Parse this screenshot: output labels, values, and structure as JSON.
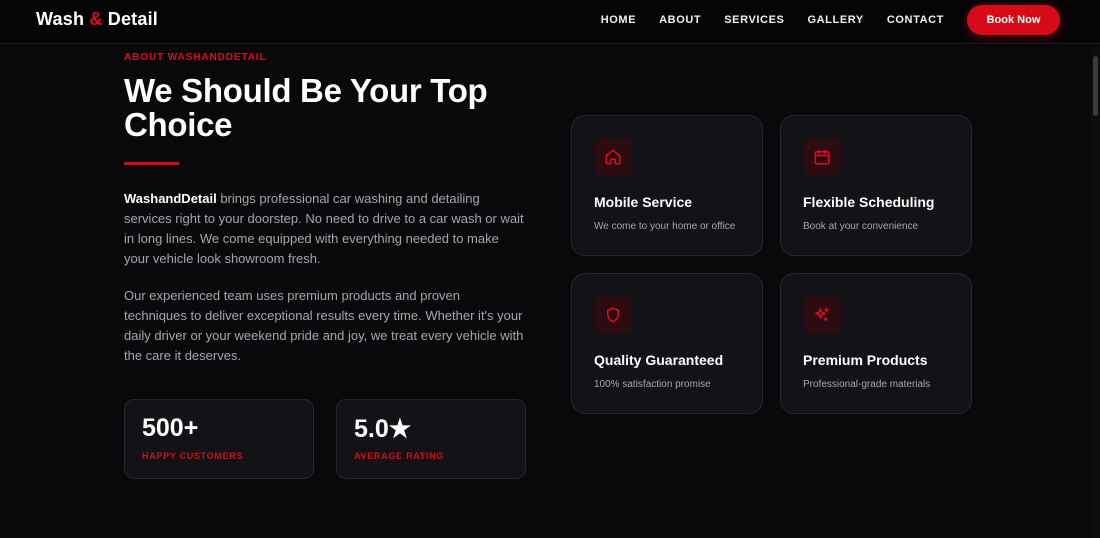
{
  "nav": {
    "logo_part1": "Wash",
    "logo_amp": "&",
    "logo_part2": "Detail",
    "links": [
      "HOME",
      "ABOUT",
      "SERVICES",
      "GALLERY",
      "CONTACT"
    ],
    "cta_label": "Book Now"
  },
  "about": {
    "eyebrow": "ABOUT WASHANDDETAIL",
    "title": "We Should Be Your Top Choice",
    "para1_brand": "WashandDetail",
    "para1_rest": " brings professional car washing and detailing services right to your doorstep. No need to drive to a car wash or wait in long lines. We come equipped with everything needed to make your vehicle look showroom fresh.",
    "para2": "Our experienced team uses premium products and proven techniques to deliver exceptional results every time. Whether it's your daily driver or your weekend pride and joy, we treat every vehicle with the care it deserves."
  },
  "stats": [
    {
      "value": "500+",
      "label": "HAPPY CUSTOMERS"
    },
    {
      "value": "5.0★",
      "label": "AVERAGE RATING"
    }
  ],
  "features": [
    {
      "icon": "home-icon",
      "title": "Mobile Service",
      "desc": "We come to your home or office"
    },
    {
      "icon": "calendar-icon",
      "title": "Flexible Scheduling",
      "desc": "Book at your convenience"
    },
    {
      "icon": "shield-icon",
      "title": "Quality Guaranteed",
      "desc": "100% satisfaction promise"
    },
    {
      "icon": "sparkles-icon",
      "title": "Premium Products",
      "desc": "Professional-grade materials"
    }
  ],
  "colors": {
    "accent": "#d70a17",
    "background": "#09080b",
    "card": "#131216",
    "muted_text": "#a7a6ab"
  }
}
